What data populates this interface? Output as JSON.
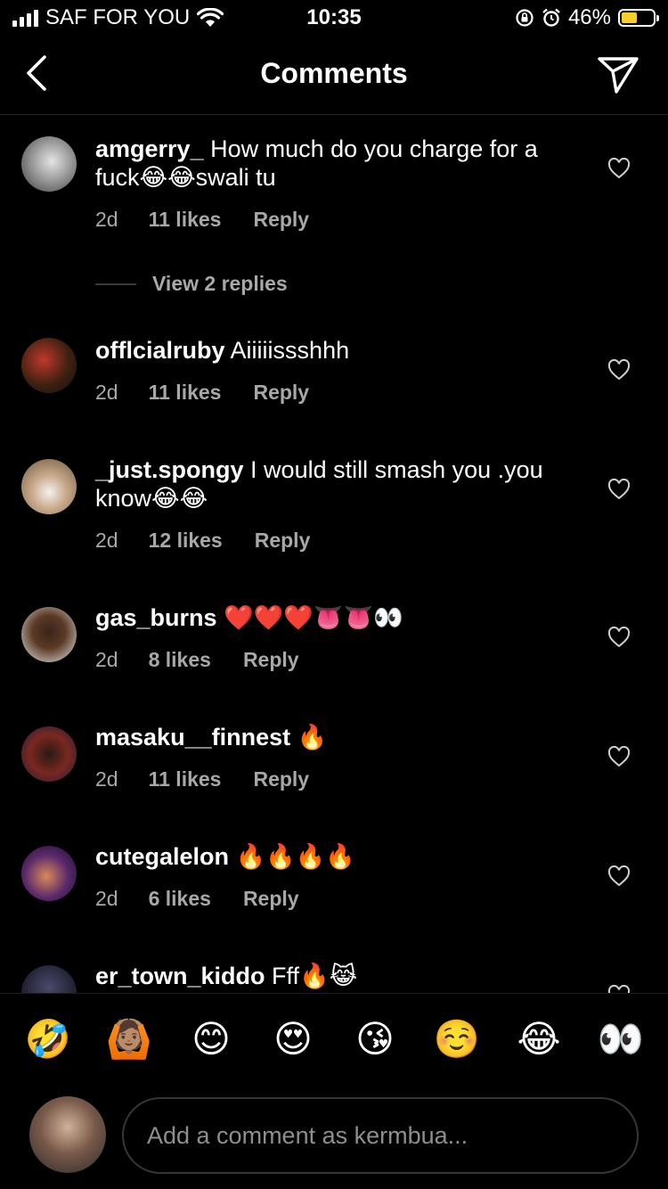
{
  "status_bar": {
    "carrier": "SAF FOR YOU",
    "time": "10:35",
    "battery": "46%",
    "battery_level": 0.46
  },
  "header": {
    "title": "Comments",
    "back_icon": "chevron-left-icon",
    "send_icon": "paper-plane-icon"
  },
  "comments": [
    {
      "username": "amgerry_",
      "text": "How much do you charge for a fuck😂😂swali tu",
      "time": "2d",
      "likes": "11 likes",
      "reply": "Reply",
      "view_replies": "View 2 replies"
    },
    {
      "username": "offlcialruby",
      "text": "Aiiiiissshhh",
      "time": "2d",
      "likes": "11 likes",
      "reply": "Reply"
    },
    {
      "username": "_just.spongy",
      "text": "I would still smash you .you know😂😂",
      "time": "2d",
      "likes": "12 likes",
      "reply": "Reply"
    },
    {
      "username": "gas_burns",
      "text": "❤️❤️❤️👅👅👀",
      "time": "2d",
      "likes": "8 likes",
      "reply": "Reply"
    },
    {
      "username": "masaku__finnest",
      "text": "🔥",
      "time": "2d",
      "likes": "11 likes",
      "reply": "Reply"
    },
    {
      "username": "cutegalelon",
      "text": "🔥🔥🔥🔥",
      "time": "2d",
      "likes": "6 likes",
      "reply": "Reply"
    },
    {
      "username": "er_town_kiddo",
      "text": "Fff🔥😹"
    }
  ],
  "emoji_bar": [
    "🤣",
    "🙆🏽",
    "😊",
    "😍",
    "😘",
    "☺️",
    "😂",
    "👀"
  ],
  "composer": {
    "placeholder": "Add a comment as kermbua..."
  },
  "colors": {
    "background": "#000000",
    "secondary_text": "#a8a8a8",
    "battery_fill": "#f6cf2b"
  }
}
